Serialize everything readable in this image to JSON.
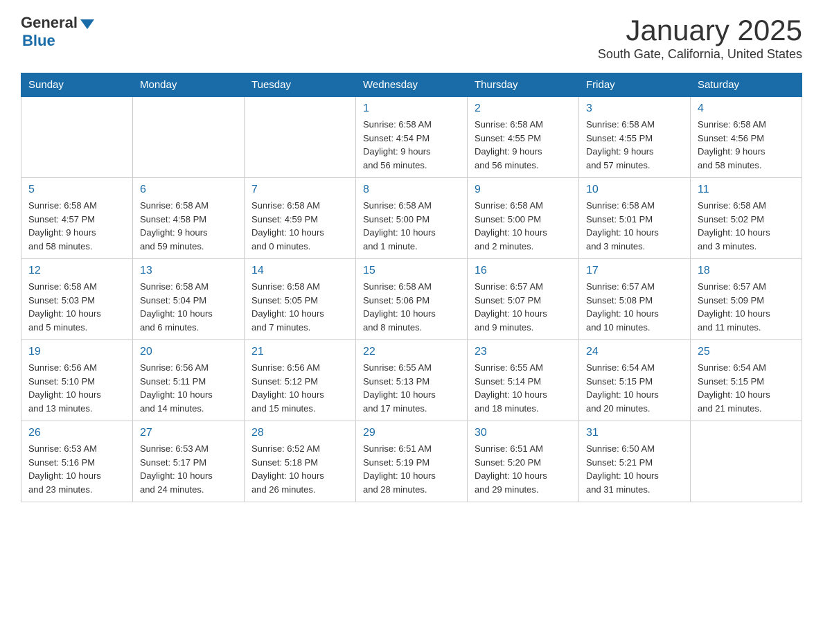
{
  "header": {
    "logo_general": "General",
    "logo_blue": "Blue",
    "month_title": "January 2025",
    "location": "South Gate, California, United States"
  },
  "days_of_week": [
    "Sunday",
    "Monday",
    "Tuesday",
    "Wednesday",
    "Thursday",
    "Friday",
    "Saturday"
  ],
  "weeks": [
    [
      {
        "day": "",
        "info": ""
      },
      {
        "day": "",
        "info": ""
      },
      {
        "day": "",
        "info": ""
      },
      {
        "day": "1",
        "info": "Sunrise: 6:58 AM\nSunset: 4:54 PM\nDaylight: 9 hours\nand 56 minutes."
      },
      {
        "day": "2",
        "info": "Sunrise: 6:58 AM\nSunset: 4:55 PM\nDaylight: 9 hours\nand 56 minutes."
      },
      {
        "day": "3",
        "info": "Sunrise: 6:58 AM\nSunset: 4:55 PM\nDaylight: 9 hours\nand 57 minutes."
      },
      {
        "day": "4",
        "info": "Sunrise: 6:58 AM\nSunset: 4:56 PM\nDaylight: 9 hours\nand 58 minutes."
      }
    ],
    [
      {
        "day": "5",
        "info": "Sunrise: 6:58 AM\nSunset: 4:57 PM\nDaylight: 9 hours\nand 58 minutes."
      },
      {
        "day": "6",
        "info": "Sunrise: 6:58 AM\nSunset: 4:58 PM\nDaylight: 9 hours\nand 59 minutes."
      },
      {
        "day": "7",
        "info": "Sunrise: 6:58 AM\nSunset: 4:59 PM\nDaylight: 10 hours\nand 0 minutes."
      },
      {
        "day": "8",
        "info": "Sunrise: 6:58 AM\nSunset: 5:00 PM\nDaylight: 10 hours\nand 1 minute."
      },
      {
        "day": "9",
        "info": "Sunrise: 6:58 AM\nSunset: 5:00 PM\nDaylight: 10 hours\nand 2 minutes."
      },
      {
        "day": "10",
        "info": "Sunrise: 6:58 AM\nSunset: 5:01 PM\nDaylight: 10 hours\nand 3 minutes."
      },
      {
        "day": "11",
        "info": "Sunrise: 6:58 AM\nSunset: 5:02 PM\nDaylight: 10 hours\nand 3 minutes."
      }
    ],
    [
      {
        "day": "12",
        "info": "Sunrise: 6:58 AM\nSunset: 5:03 PM\nDaylight: 10 hours\nand 5 minutes."
      },
      {
        "day": "13",
        "info": "Sunrise: 6:58 AM\nSunset: 5:04 PM\nDaylight: 10 hours\nand 6 minutes."
      },
      {
        "day": "14",
        "info": "Sunrise: 6:58 AM\nSunset: 5:05 PM\nDaylight: 10 hours\nand 7 minutes."
      },
      {
        "day": "15",
        "info": "Sunrise: 6:58 AM\nSunset: 5:06 PM\nDaylight: 10 hours\nand 8 minutes."
      },
      {
        "day": "16",
        "info": "Sunrise: 6:57 AM\nSunset: 5:07 PM\nDaylight: 10 hours\nand 9 minutes."
      },
      {
        "day": "17",
        "info": "Sunrise: 6:57 AM\nSunset: 5:08 PM\nDaylight: 10 hours\nand 10 minutes."
      },
      {
        "day": "18",
        "info": "Sunrise: 6:57 AM\nSunset: 5:09 PM\nDaylight: 10 hours\nand 11 minutes."
      }
    ],
    [
      {
        "day": "19",
        "info": "Sunrise: 6:56 AM\nSunset: 5:10 PM\nDaylight: 10 hours\nand 13 minutes."
      },
      {
        "day": "20",
        "info": "Sunrise: 6:56 AM\nSunset: 5:11 PM\nDaylight: 10 hours\nand 14 minutes."
      },
      {
        "day": "21",
        "info": "Sunrise: 6:56 AM\nSunset: 5:12 PM\nDaylight: 10 hours\nand 15 minutes."
      },
      {
        "day": "22",
        "info": "Sunrise: 6:55 AM\nSunset: 5:13 PM\nDaylight: 10 hours\nand 17 minutes."
      },
      {
        "day": "23",
        "info": "Sunrise: 6:55 AM\nSunset: 5:14 PM\nDaylight: 10 hours\nand 18 minutes."
      },
      {
        "day": "24",
        "info": "Sunrise: 6:54 AM\nSunset: 5:15 PM\nDaylight: 10 hours\nand 20 minutes."
      },
      {
        "day": "25",
        "info": "Sunrise: 6:54 AM\nSunset: 5:15 PM\nDaylight: 10 hours\nand 21 minutes."
      }
    ],
    [
      {
        "day": "26",
        "info": "Sunrise: 6:53 AM\nSunset: 5:16 PM\nDaylight: 10 hours\nand 23 minutes."
      },
      {
        "day": "27",
        "info": "Sunrise: 6:53 AM\nSunset: 5:17 PM\nDaylight: 10 hours\nand 24 minutes."
      },
      {
        "day": "28",
        "info": "Sunrise: 6:52 AM\nSunset: 5:18 PM\nDaylight: 10 hours\nand 26 minutes."
      },
      {
        "day": "29",
        "info": "Sunrise: 6:51 AM\nSunset: 5:19 PM\nDaylight: 10 hours\nand 28 minutes."
      },
      {
        "day": "30",
        "info": "Sunrise: 6:51 AM\nSunset: 5:20 PM\nDaylight: 10 hours\nand 29 minutes."
      },
      {
        "day": "31",
        "info": "Sunrise: 6:50 AM\nSunset: 5:21 PM\nDaylight: 10 hours\nand 31 minutes."
      },
      {
        "day": "",
        "info": ""
      }
    ]
  ]
}
